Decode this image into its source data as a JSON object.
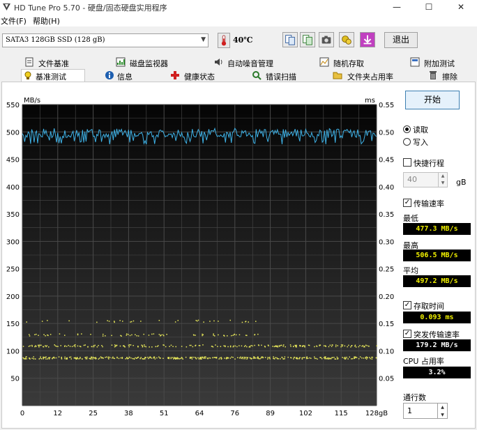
{
  "window": {
    "title": "HD Tune Pro 5.70 - 硬盘/固态硬盘实用程序",
    "minimize": "—",
    "maximize": "☐",
    "close": "✕"
  },
  "menu": [
    "文件(F)",
    "帮助(H)"
  ],
  "toolbar": {
    "drive": "SATA3 128GB SSD (128 gB)",
    "temperature": "40℃",
    "exit_label": "退出",
    "icons": [
      "copy-text-icon",
      "copy-image-icon",
      "camera-icon",
      "options-icon",
      "save-icon"
    ]
  },
  "tabs": {
    "row1": [
      {
        "label": "文件基准",
        "icon": "file-benchmark-icon"
      },
      {
        "label": "磁盘监视器",
        "icon": "disk-monitor-icon"
      },
      {
        "label": "自动噪音管理",
        "icon": "speaker-icon"
      },
      {
        "label": "随机存取",
        "icon": "random-access-icon"
      },
      {
        "label": "附加测试",
        "icon": "extra-tests-icon"
      }
    ],
    "row2": [
      {
        "label": "基准测试",
        "icon": "benchmark-icon",
        "active": true
      },
      {
        "label": "信息",
        "icon": "info-icon"
      },
      {
        "label": "健康状态",
        "icon": "health-icon"
      },
      {
        "label": "错误扫描",
        "icon": "error-scan-icon"
      },
      {
        "label": "文件夹占用率",
        "icon": "folder-icon"
      },
      {
        "label": "擦除",
        "icon": "erase-icon"
      }
    ]
  },
  "controls": {
    "start_label": "开始",
    "read_label": "读取",
    "write_label": "写入",
    "mode": "read",
    "short_stroke_label": "快捷行程",
    "short_stroke_checked": false,
    "short_stroke_value": "40",
    "short_stroke_unit": "gB",
    "transfer_rate_label": "传输速率",
    "transfer_rate_checked": true,
    "min_label": "最低",
    "min_value": "477.3 MB/s",
    "max_label": "最高",
    "max_value": "506.5 MB/s",
    "avg_label": "平均",
    "avg_value": "497.2 MB/s",
    "access_time_label": "存取时间",
    "access_time_checked": true,
    "access_time_value": "0.093 ms",
    "burst_label": "突发传输速率",
    "burst_checked": true,
    "burst_value": "179.2 MB/s",
    "cpu_label": "CPU 占用率",
    "cpu_value": "3.2%",
    "passes_label": "通行数",
    "passes_value": "1"
  },
  "chart_data": {
    "type": "line",
    "left_unit": "MB/s",
    "right_unit": "ms",
    "y_left_ticks": [
      "550",
      "500",
      "450",
      "400",
      "350",
      "300",
      "250",
      "200",
      "150",
      "100",
      "50"
    ],
    "y_right_ticks": [
      "0.55",
      "0.50",
      "0.45",
      "0.40",
      "0.35",
      "0.30",
      "0.25",
      "0.20",
      "0.15",
      "0.10",
      "0.05"
    ],
    "x_ticks": [
      "0",
      "12",
      "25",
      "38",
      "51",
      "64",
      "76",
      "89",
      "102",
      "115",
      "128gB"
    ],
    "ylim_left": [
      0,
      550
    ],
    "ylim_right": [
      0,
      0.55
    ],
    "xlim": [
      0,
      128
    ],
    "grid": true,
    "series": [
      {
        "kind": "transfer-rate",
        "color": "#3fb3e8",
        "min": 477.3,
        "max": 506.5,
        "avg": 497.2
      },
      {
        "kind": "access-time",
        "color": "#e8e85a",
        "clusters_ms": [
          0.088,
          0.11,
          0.13,
          0.155
        ],
        "x_range": [
          0,
          128
        ]
      }
    ]
  }
}
